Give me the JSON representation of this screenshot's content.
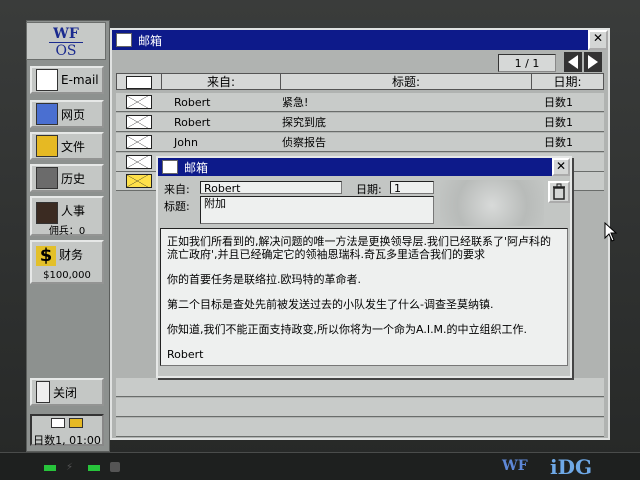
{
  "logo": {
    "top": "WF",
    "bottom": "OS"
  },
  "sidebar": {
    "email": "E-mail",
    "web": "网页",
    "files": "文件",
    "history": "历史",
    "personnel": "人事",
    "mercs_label": "佣兵：",
    "mercs_value": "0",
    "finance": "财务",
    "money": "$100,000",
    "close": "关闭",
    "clock": "日数1, 01:00"
  },
  "mailbox": {
    "title": "邮箱",
    "page": "1 / 1",
    "columns": {
      "from": "来自:",
      "subject": "标题:",
      "date": "日期:"
    },
    "rows": [
      {
        "from": "Robert",
        "subject": "紧急!",
        "date": "日数1"
      },
      {
        "from": "Robert",
        "subject": "探究到底",
        "date": "日数1"
      },
      {
        "from": "John",
        "subject": "侦察报告",
        "date": "日数1"
      }
    ]
  },
  "message": {
    "title": "邮箱",
    "from_label": "来自:",
    "from_value": "Robert",
    "date_label": "日期:",
    "date_value": "1",
    "subject_label": "标题:",
    "subject_value": "附加",
    "paragraphs": [
      "正如我们所看到的,解决问题的唯一方法是更换领导层.我们已经联系了'阿卢科的流亡政府',并且已经确定它的领袖恩瑞科.奇瓦多里适合我们的要求",
      "你的首要任务是联络拉.欧玛特的革命者.",
      "第二个目标是查处先前被发送过去的小队发生了什么-调查圣莫纳镇.",
      "你知道,我们不能正面支持政变,所以你将为一个命为A.I.M.的中立组织工作.",
      "Robert"
    ]
  },
  "brand": {
    "left": "WF",
    "right": "iDG"
  }
}
